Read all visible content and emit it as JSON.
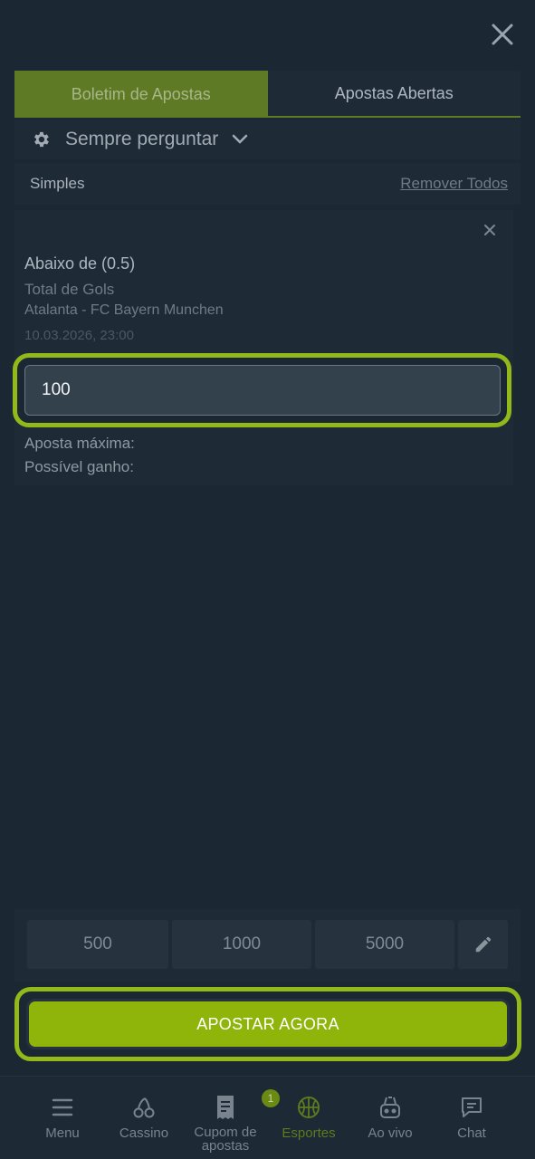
{
  "tabs": [
    {
      "label": "Boletim de Apostas",
      "active": true
    },
    {
      "label": "Apostas Abertas",
      "active": false
    }
  ],
  "settings": {
    "label": "Sempre perguntar",
    "icon": "gear-icon"
  },
  "slip": {
    "type_label": "Simples",
    "remove_all": "Remover Todos"
  },
  "bet": {
    "selection": "Abaixo de (0.5)",
    "market": "Total de Gols",
    "match": "Atalanta - FC Bayern Munchen",
    "datetime": "10.03.2026, 23:00",
    "stake": "100",
    "max_label": "Aposta máxima:",
    "gain_label": "Possível ganho:"
  },
  "quick_amounts": [
    "500",
    "1000",
    "5000"
  ],
  "place_bet_label": "APOSTAR AGORA",
  "nav": [
    {
      "label": "Menu",
      "icon": "menu-icon"
    },
    {
      "label": "Cassino",
      "icon": "cherries-icon"
    },
    {
      "label": "Cupom de apostas",
      "icon": "receipt-icon",
      "badge": "1"
    },
    {
      "label": "Esportes",
      "icon": "basketball-icon",
      "active": true
    },
    {
      "label": "Ao vivo",
      "icon": "live-icon"
    },
    {
      "label": "Chat",
      "icon": "chat-icon"
    }
  ],
  "colors": {
    "accent": "#93b81a",
    "background": "#1b2834",
    "panel": "#1e2b37"
  }
}
